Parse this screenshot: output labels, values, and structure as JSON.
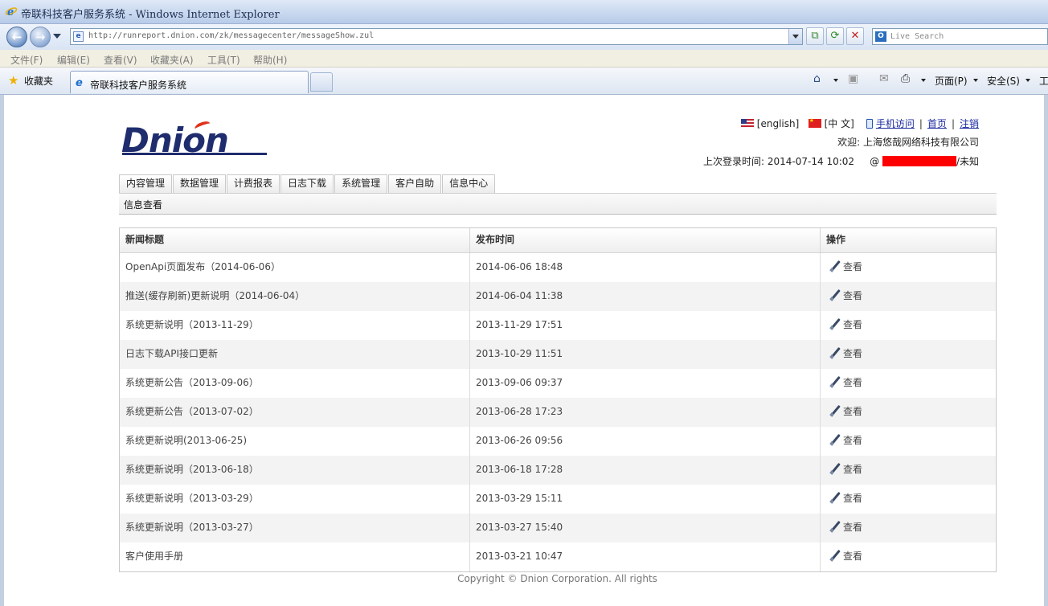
{
  "browser": {
    "title": "帝联科技客户服务系统 - Windows Internet Explorer",
    "url": "http://runreport.dnion.com/zk/messagecenter/messageShow.zul",
    "search_placeholder": "Live Search",
    "menu": [
      "文件(F)",
      "编辑(E)",
      "查看(V)",
      "收藏夹(A)",
      "工具(T)",
      "帮助(H)"
    ],
    "favorites_label": "收藏夹",
    "tab_title": "帝联科技客户服务系统",
    "commands": {
      "page": "页面(P)",
      "safety": "安全(S)",
      "tools": "工"
    }
  },
  "site": {
    "logo_text": "Dnion",
    "lang_english": "[english]",
    "lang_chinese": "[中 文]",
    "mobile": "手机访问",
    "home": "首页",
    "logout": "注销",
    "welcome": "欢迎: 上海悠哉网络科技有限公司",
    "last_login_label": "上次登录时间:",
    "last_login_time": "2014-07-14 10:02",
    "at": "@",
    "location": "/未知"
  },
  "nav_tabs": [
    "内容管理",
    "数据管理",
    "计费报表",
    "日志下载",
    "系统管理",
    "客户自助",
    "信息中心"
  ],
  "section_title": "信息查看",
  "table": {
    "headers": [
      "新闻标题",
      "发布时间",
      "操作"
    ],
    "rows": [
      {
        "title": "OpenApi页面发布（2014-06-06）",
        "time": "2014-06-06 18:48",
        "action": "查看"
      },
      {
        "title": "推送(缓存刷新)更新说明（2014-06-04）",
        "time": "2014-06-04 11:38",
        "action": "查看"
      },
      {
        "title": "系统更新说明（2013-11-29）",
        "time": "2013-11-29 17:51",
        "action": "查看"
      },
      {
        "title": "日志下载API接口更新",
        "time": "2013-10-29 11:51",
        "action": "查看"
      },
      {
        "title": "系统更新公告（2013-09-06）",
        "time": "2013-09-06 09:37",
        "action": "查看"
      },
      {
        "title": "系统更新公告（2013-07-02）",
        "time": "2013-06-28 17:23",
        "action": "查看"
      },
      {
        "title": "系统更新说明(2013-06-25)",
        "time": "2013-06-26 09:56",
        "action": "查看"
      },
      {
        "title": "系统更新说明（2013-06-18）",
        "time": "2013-06-18 17:28",
        "action": "查看"
      },
      {
        "title": "系统更新说明（2013-03-29）",
        "time": "2013-03-29 15:11",
        "action": "查看"
      },
      {
        "title": "系统更新说明（2013-03-27）",
        "time": "2013-03-27 15:40",
        "action": "查看"
      },
      {
        "title": "客户使用手册",
        "time": "2013-03-21 10:47",
        "action": "查看"
      }
    ]
  },
  "footer": "Copyright © Dnion Corporation. All rights"
}
